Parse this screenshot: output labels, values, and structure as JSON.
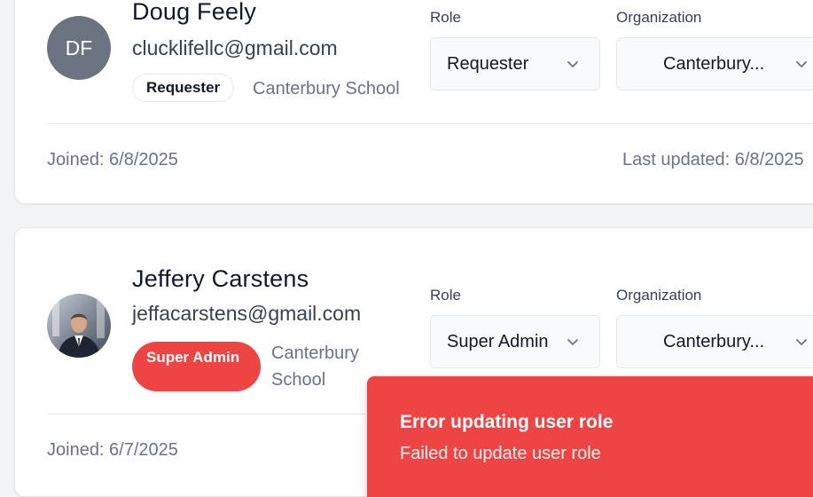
{
  "users": [
    {
      "name": "Doug Feely",
      "email": "clucklifellc@gmail.com",
      "initials": "DF",
      "role_badge": "Requester",
      "organization": "Canterbury School",
      "role_label": "Role",
      "role_value": "Requester",
      "org_label": "Organization",
      "org_value": "Canterbury...",
      "joined": "Joined: 6/8/2025",
      "last_updated": "Last updated: 6/8/2025"
    },
    {
      "name": "Jeffery Carstens",
      "email": "jeffacarstens@gmail.com",
      "avatar": "profile-photo",
      "role_badge": "Super Admin",
      "organization": "Canterbury School",
      "role_label": "Role",
      "role_value": "Super Admin",
      "org_label": "Organization",
      "org_value": "Canterbury...",
      "joined": "Joined: 6/7/2025"
    }
  ],
  "toast": {
    "title": "Error updating user role",
    "message": "Failed to update user role"
  },
  "colors": {
    "error": "#ef4444",
    "avatar_bg": "#6b7280",
    "background": "#f3f4f6"
  },
  "icons": {
    "select_chevron": "chevron-down-icon"
  }
}
